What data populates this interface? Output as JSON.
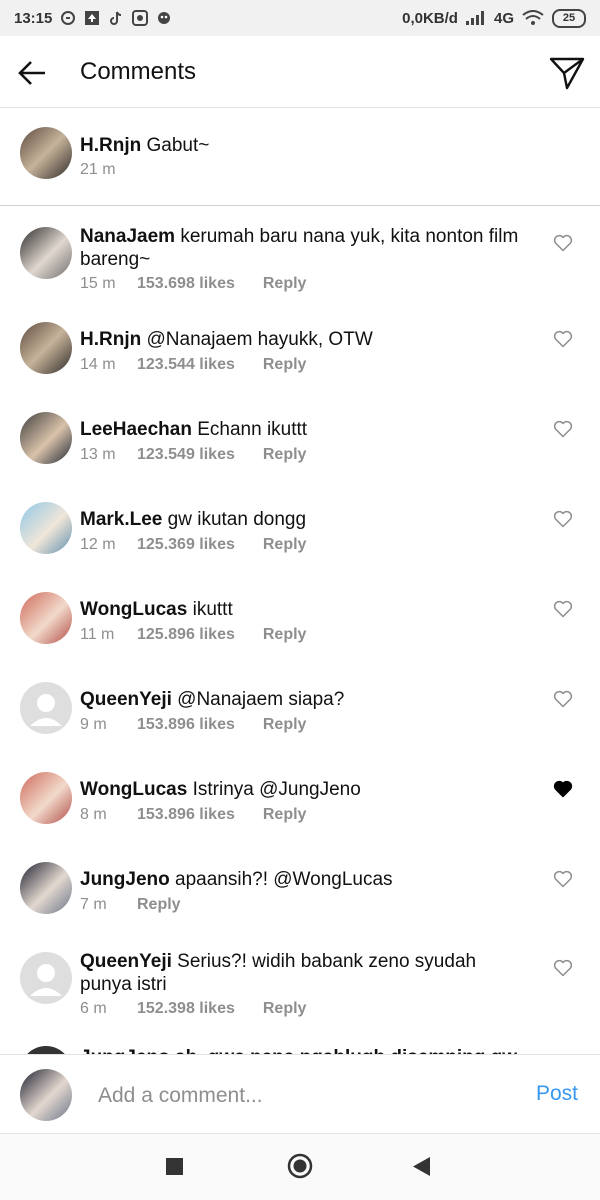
{
  "status_bar": {
    "time": "13:15",
    "data_rate": "0,0KB/d",
    "network": "4G",
    "battery": "25"
  },
  "header": {
    "title": "Comments"
  },
  "caption": {
    "user": "H.Rnjn",
    "text": "Gabut~",
    "time": "21 m"
  },
  "comments": [
    {
      "user": "NanaJaem",
      "text": "kerumah baru nana yuk, kita nonton film bareng~",
      "time": "15 m",
      "likes": "153.698 likes",
      "reply": "Reply",
      "liked": false
    },
    {
      "user": "H.Rnjn",
      "text": "@Nanajaem hayukk, OTW",
      "time": "14 m",
      "likes": "123.544 likes",
      "reply": "Reply",
      "liked": false
    },
    {
      "user": "LeeHaechan",
      "text": "Echann ikuttt",
      "time": "13 m",
      "likes": "123.549 likes",
      "reply": "Reply",
      "liked": false
    },
    {
      "user": "Mark.Lee",
      "text": "gw ikutan dongg",
      "time": "12 m",
      "likes": "125.369 likes",
      "reply": "Reply",
      "liked": false
    },
    {
      "user": "WongLucas",
      "text": "ikuttt",
      "time": "11 m",
      "likes": "125.896 likes",
      "reply": "Reply",
      "liked": false
    },
    {
      "user": "QueenYeji",
      "text": "@Nanajaem siapa?",
      "time": "9 m",
      "likes": "153.896 likes",
      "reply": "Reply",
      "liked": false
    },
    {
      "user": "WongLucas",
      "text": "Istrinya @JungJeno",
      "time": "8 m",
      "likes": "153.896 likes",
      "reply": "Reply",
      "liked": true
    },
    {
      "user": "JungJeno",
      "text": "apaansih?! @WongLucas",
      "time": "7 m",
      "likes": "",
      "reply": "Reply",
      "liked": false
    },
    {
      "user": "QueenYeji",
      "text": "Serius?! widih babank zeno syudah punya istri",
      "time": "6 m",
      "likes": "152.398 likes",
      "reply": "Reply",
      "liked": false
    }
  ],
  "partial_comment": {
    "text": "JungJeno ah, gwe pena pgablugh disemping gw"
  },
  "composer": {
    "placeholder": "Add a comment...",
    "post_label": "Post"
  },
  "colors": {
    "accent": "#3897f0",
    "meta_text": "#8e8e8e"
  }
}
